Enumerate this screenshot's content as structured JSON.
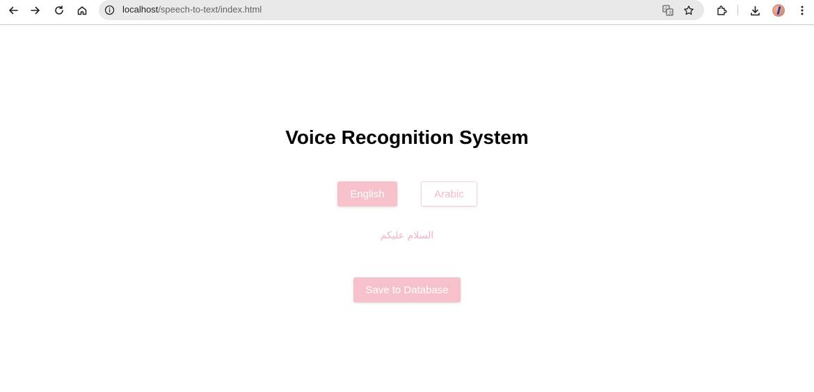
{
  "browser": {
    "url_host": "localhost",
    "url_path": "/speech-to-text/index.html"
  },
  "page": {
    "title": "Voice Recognition System",
    "language_buttons": {
      "english": "English",
      "arabic": "Arabic"
    },
    "transcript": "السلام عليكم",
    "save_label": "Save to Database"
  },
  "colors": {
    "accent_pink": "#f6c1cb",
    "text_pink": "#f3b3bf"
  },
  "icons": {
    "back": "back-arrow-icon",
    "forward": "forward-arrow-icon",
    "reload": "reload-icon",
    "home": "home-icon",
    "site_info": "info-icon",
    "translate": "translate-icon",
    "bookmark": "star-icon",
    "extensions": "puzzle-icon",
    "downloads": "download-icon",
    "menu": "kebab-menu-icon"
  }
}
